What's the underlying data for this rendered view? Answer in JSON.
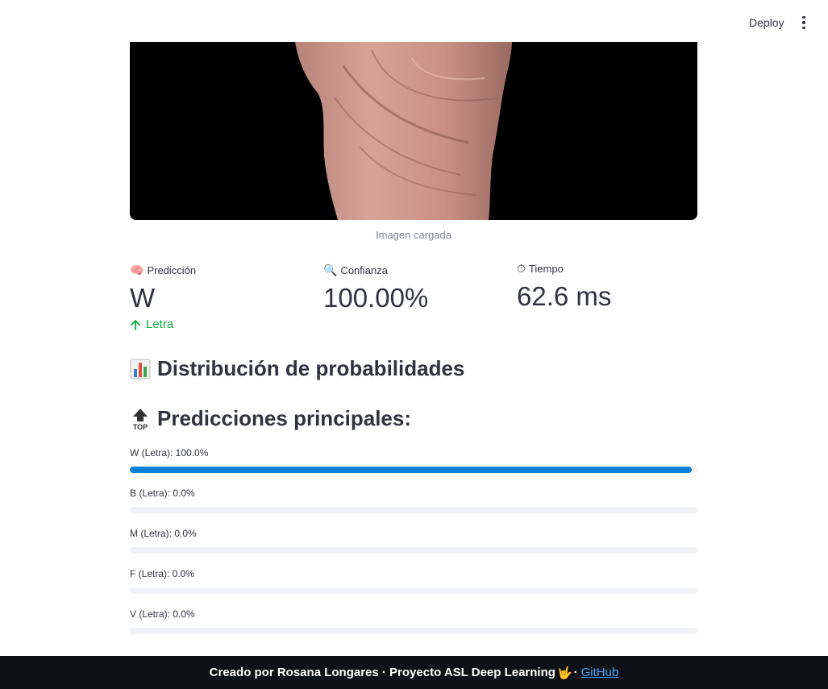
{
  "header": {
    "deploy_label": "Deploy",
    "menu_icon": "more-vertical-icon"
  },
  "image": {
    "caption": "Imagen cargada"
  },
  "metrics": [
    {
      "icon": "brain-icon",
      "emoji": "🧠",
      "label": "Predicción",
      "value": "W",
      "delta": "Letra",
      "delta_color": "#09ab3b"
    },
    {
      "icon": "magnifier-icon",
      "emoji": "🔍",
      "label": "Confianza",
      "value": "100.00%"
    },
    {
      "icon": "stopwatch-icon",
      "emoji": "⏱",
      "label": "Tiempo",
      "value": "62.6 ms"
    }
  ],
  "sections": {
    "distribution_title": "Distribución de probabilidades",
    "top_title": "Predicciones principales:"
  },
  "predictions": [
    {
      "label": "W (Letra): 100.0%",
      "value": 100.0
    },
    {
      "label": "B (Letra): 0.0%",
      "value": 0.0
    },
    {
      "label": "M (Letra): 0.0%",
      "value": 0.0
    },
    {
      "label": "F (Letra): 0.0%",
      "value": 0.0
    },
    {
      "label": "V (Letra): 0.0%",
      "value": 0.0
    }
  ],
  "colors": {
    "progress": "#0a80d8",
    "delta": "#09ab3b",
    "footer_bg": "#0e1117",
    "link": "#4aa8ff"
  },
  "footer": {
    "text": "Creado por Rosana Longares · Proyecto ASL Deep Learning",
    "hand_emoji": "🤟",
    "separator": "·",
    "link_label": "GitHub"
  }
}
